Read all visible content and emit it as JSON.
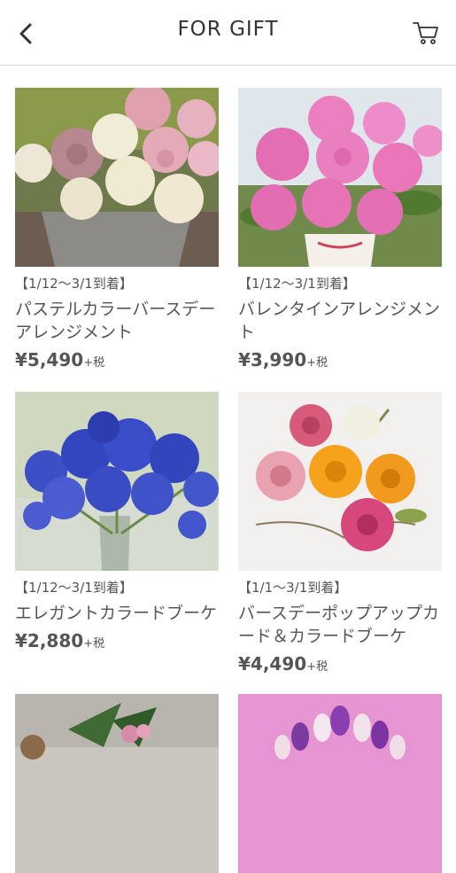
{
  "header": {
    "title": "FOR GIFT",
    "back_icon": "chevron-left-icon",
    "cart_icon": "shopping-cart-icon"
  },
  "products": [
    {
      "period": "【1/12〜3/1到着】",
      "name": "パステルカラーバースデーアレンジメント",
      "price": "¥5,490",
      "tax": "+税",
      "image": "pastel-roses-arrangement"
    },
    {
      "period": "【1/12〜3/1到着】",
      "name": "バレンタインアレンジメント",
      "price": "¥3,990",
      "tax": "+税",
      "image": "pink-roses-vase"
    },
    {
      "period": "【1/12〜3/1到着】",
      "name": "エレガントカラードブーケ",
      "price": "¥2,880",
      "tax": "+税",
      "image": "blue-flower-bouquet"
    },
    {
      "period": "【1/1〜3/1到着】",
      "name": "バースデーポップアップカード＆カラードブーケ",
      "price": "¥4,490",
      "tax": "+税",
      "image": "ranunculus-pop-up-bouquet"
    },
    {
      "image": "dark-arrangement-partial"
    },
    {
      "image": "purple-tulips-partial"
    }
  ],
  "colors": {
    "text": "#555555",
    "divider": "#d6d6d6"
  }
}
